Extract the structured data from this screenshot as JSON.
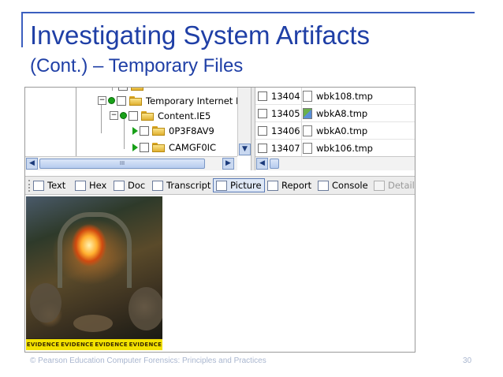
{
  "slide": {
    "title": "Investigating System Artifacts",
    "subtitle": "(Cont.) – Temporary Files",
    "footer": "© Pearson Education  Computer Forensics: Principles and Practices",
    "page_number": "30",
    "accent_color": "#1f3fa6"
  },
  "tree": {
    "nodes": [
      {
        "label": "Temporary Internet F",
        "icon": "folder-icon"
      },
      {
        "label": "Content.IE5",
        "icon": "folder-icon"
      },
      {
        "label": "0P3F8AV9",
        "icon": "folder-icon"
      },
      {
        "label": "CAMGF0IC",
        "icon": "folder-icon"
      }
    ]
  },
  "files": {
    "rows": [
      {
        "id": "13404",
        "name": "wbk108.tmp",
        "icon": "document-icon"
      },
      {
        "id": "13405",
        "name": "wbkA8.tmp",
        "icon": "image-file-icon"
      },
      {
        "id": "13406",
        "name": "wbkA0.tmp",
        "icon": "document-icon"
      },
      {
        "id": "13407",
        "name": "wbk106.tmp",
        "icon": "document-icon"
      }
    ]
  },
  "scroll": {
    "thumb_label": "III"
  },
  "tabs": [
    {
      "label": "Text",
      "icon": "text-icon"
    },
    {
      "label": "Hex",
      "icon": "hex-icon"
    },
    {
      "label": "Doc",
      "icon": "doc-icon"
    },
    {
      "label": "Transcript",
      "icon": "transcript-icon"
    },
    {
      "label": "Picture",
      "icon": "picture-icon",
      "active": true
    },
    {
      "label": "Report",
      "icon": "report-icon"
    },
    {
      "label": "Console",
      "icon": "console-icon"
    },
    {
      "label": "Details",
      "icon": "details-icon",
      "disabled": true
    }
  ],
  "picture": {
    "caption_words": [
      "EVIDENCE",
      "EVIDENCE",
      "EVIDENCE",
      "EVIDENCE"
    ]
  }
}
